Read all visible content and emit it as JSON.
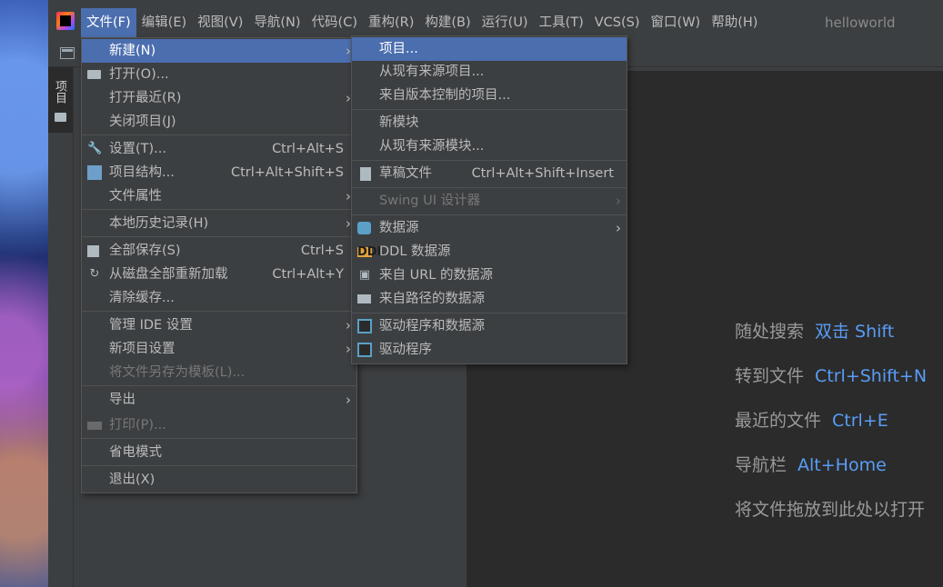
{
  "menubar": {
    "items": [
      {
        "label": "文件(F)"
      },
      {
        "label": "编辑(E)"
      },
      {
        "label": "视图(V)"
      },
      {
        "label": "导航(N)"
      },
      {
        "label": "代码(C)"
      },
      {
        "label": "重构(R)"
      },
      {
        "label": "构建(B)"
      },
      {
        "label": "运行(U)"
      },
      {
        "label": "工具(T)"
      },
      {
        "label": "VCS(S)"
      },
      {
        "label": "窗口(W)"
      },
      {
        "label": "帮助(H)"
      }
    ],
    "active_index": 0,
    "window_title": "helloworld"
  },
  "tool_window": {
    "project_tab_label": "项目"
  },
  "file_menu": {
    "items": [
      {
        "label": "新建(N)",
        "shortcut": "",
        "submenu": true,
        "selected": true
      },
      {
        "label": "打开(O)...",
        "shortcut": "",
        "icon": "folder-icon"
      },
      {
        "label": "打开最近(R)",
        "shortcut": "",
        "submenu": true
      },
      {
        "label": "关闭项目(J)",
        "shortcut": ""
      },
      {
        "label": "设置(T)...",
        "shortcut": "Ctrl+Alt+S",
        "icon": "wrench-icon"
      },
      {
        "label": "项目结构...",
        "shortcut": "Ctrl+Alt+Shift+S",
        "icon": "project-structure-icon"
      },
      {
        "label": "文件属性",
        "shortcut": "",
        "submenu": true
      },
      {
        "label": "本地历史记录(H)",
        "shortcut": "",
        "submenu": true
      },
      {
        "label": "全部保存(S)",
        "shortcut": "Ctrl+S",
        "icon": "save-icon"
      },
      {
        "label": "从磁盘全部重新加载",
        "shortcut": "Ctrl+Alt+Y",
        "icon": "reload-icon"
      },
      {
        "label": "清除缓存...",
        "shortcut": ""
      },
      {
        "label": "管理 IDE 设置",
        "shortcut": "",
        "submenu": true
      },
      {
        "label": "新项目设置",
        "shortcut": "",
        "submenu": true
      },
      {
        "label": "将文件另存为模板(L)...",
        "shortcut": "",
        "disabled": true
      },
      {
        "label": "导出",
        "shortcut": "",
        "submenu": true
      },
      {
        "label": "打印(P)...",
        "shortcut": "",
        "disabled": true,
        "icon": "print-icon"
      },
      {
        "label": "省电模式",
        "shortcut": ""
      },
      {
        "label": "退出(X)",
        "shortcut": ""
      }
    ]
  },
  "new_submenu": {
    "items": [
      {
        "label": "项目...",
        "selected": true
      },
      {
        "label": "从现有来源项目..."
      },
      {
        "label": "来自版本控制的项目..."
      },
      {
        "label": "新模块"
      },
      {
        "label": "从现有来源模块..."
      },
      {
        "label": "草稿文件",
        "shortcut": "Ctrl+Alt+Shift+Insert",
        "icon": "scratch-file-icon"
      },
      {
        "label": "Swing UI 设计器",
        "disabled": true,
        "submenu": true
      },
      {
        "label": "数据源",
        "submenu": true,
        "icon": "database-icon"
      },
      {
        "label": "DDL 数据源",
        "icon": "ddl-icon",
        "icon_text": "DDL"
      },
      {
        "label": "来自 URL 的数据源",
        "icon": "url-datasource-icon"
      },
      {
        "label": "来自路径的数据源",
        "icon": "folder-icon"
      },
      {
        "label": "驱动程序和数据源",
        "icon": "driver-icon"
      },
      {
        "label": "驱动程序",
        "icon": "driver-icon"
      }
    ]
  },
  "editor_hints": [
    {
      "label": "随处搜索",
      "key": "双击 Shift"
    },
    {
      "label": "转到文件",
      "key": "Ctrl+Shift+N"
    },
    {
      "label": "最近的文件",
      "key": "Ctrl+E"
    },
    {
      "label": "导航栏",
      "key": "Alt+Home"
    },
    {
      "label": "将文件拖放到此处以打开",
      "key": ""
    }
  ],
  "colors": {
    "selection": "#4b6eaf",
    "hint_key": "#589df6",
    "background": "#3c3f41",
    "editor": "#2b2b2b"
  }
}
